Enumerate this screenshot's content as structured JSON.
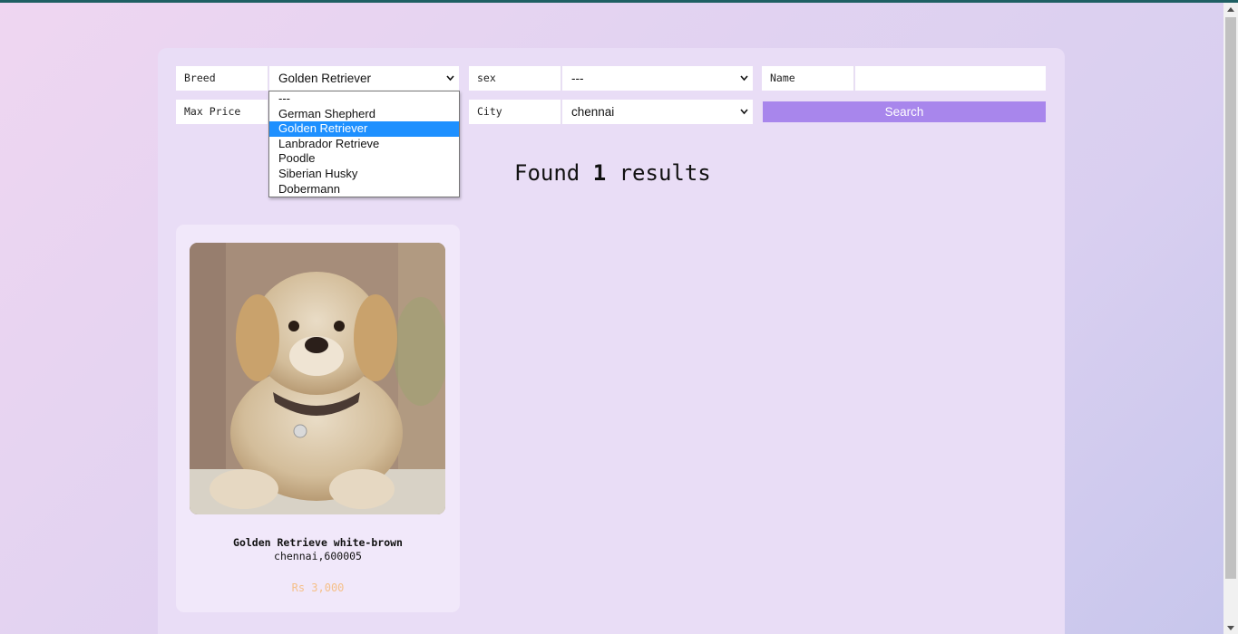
{
  "filters": {
    "breed": {
      "label": "Breed",
      "value": "Golden Retriever"
    },
    "sex": {
      "label": "sex",
      "value": "---"
    },
    "name": {
      "label": "Name",
      "value": ""
    },
    "max_price": {
      "label": "Max Price"
    },
    "city": {
      "label": "City",
      "value": "chennai"
    },
    "search_label": "Search"
  },
  "breed_dropdown": {
    "options": [
      "---",
      "German Shepherd",
      "Golden Retriever",
      "Lanbrador Retrieve",
      "Poodle",
      "Siberian Husky",
      "Dobermann"
    ],
    "selected": "Golden Retriever"
  },
  "results": {
    "prefix": "Found",
    "count": "1",
    "suffix": "results"
  },
  "listing": {
    "title": "Golden Retrieve white-brown",
    "location": "chennai,600005",
    "price": "Rs 3,000"
  },
  "colors": {
    "accent": "#a886ec",
    "price": "#f5c08a",
    "selected_option": "#1e90ff"
  }
}
